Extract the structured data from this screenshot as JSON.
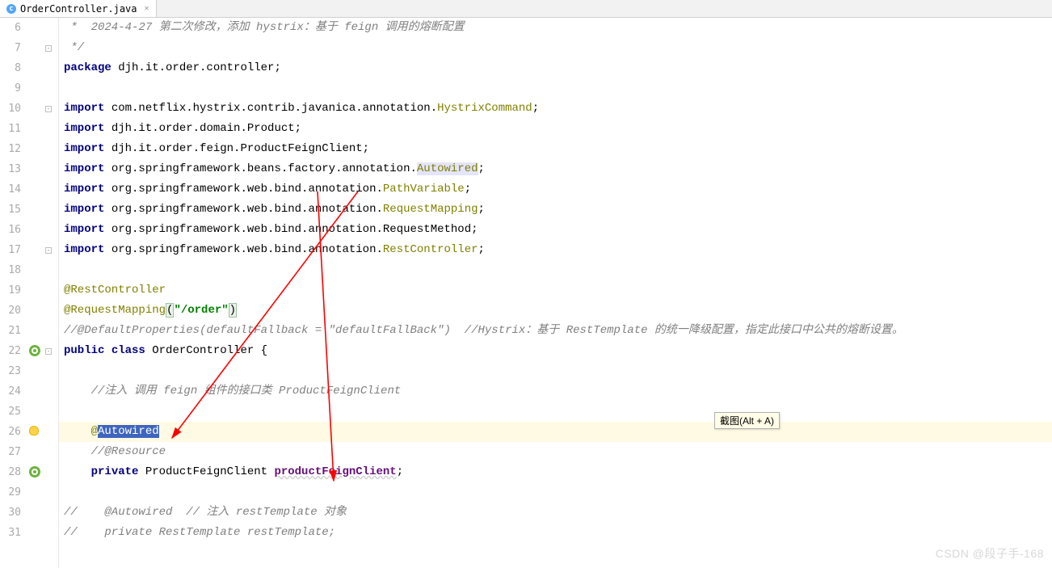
{
  "tabs": {
    "file_name": "OrderController.java",
    "file_icon_letter": "c"
  },
  "line_numbers": [
    "6",
    "7",
    "8",
    "9",
    "10",
    "11",
    "12",
    "13",
    "14",
    "15",
    "16",
    "17",
    "18",
    "19",
    "20",
    "21",
    "22",
    "23",
    "24",
    "25",
    "26",
    "27",
    "28",
    "29",
    "30",
    "31"
  ],
  "tooltip": "截图(Alt + A)",
  "watermark": "CSDN @段子手-168",
  "tokens": {
    "kw_package": "package",
    "kw_import": "import",
    "kw_public": "public",
    "kw_class": "class",
    "kw_private": "private",
    "pkg_name": " djh.it.order.controller;",
    "imp1_pre": " com.netflix.hystrix.contrib.javanica.annotation.",
    "imp1_cls": "HystrixCommand",
    "imp2": " djh.it.order.domain.Product;",
    "imp3": " djh.it.order.feign.ProductFeignClient;",
    "imp4_pre": " org.springframework.beans.factory.annotation.",
    "imp4_cls": "Autowired",
    "imp5_pre": " org.springframework.web.bind.annotation.",
    "imp5_cls": "PathVariable",
    "imp6_cls": "RequestMapping",
    "imp7_cls": "RequestMethod;",
    "imp8_cls": "RestController",
    "ann_rest": "@RestController",
    "ann_reqmap": "@RequestMapping",
    "reqmap_val": "\"/order\"",
    "comment_top": " *  2024-4-27 第二次修改，添加 hystrix：基于 feign 调用的熔断配置",
    "comment_end": " */",
    "comment_defprop": "//@DefaultProperties(defaultFallback = \"defaultFallBack\")  //Hystrix：基于 RestTemplate 的统一降级配置，指定此接口中公共的熔断设置。",
    "comment_inject": "    //注入 调用 feign 组件的接口类 ProductFeignClient",
    "comment_resource": "    //@Resource",
    "comment_autowired_line": "//    @Autowired  // 注入 restTemplate 对象",
    "comment_resttemplate": "//    private RestTemplate restTemplate;",
    "at": "@",
    "autowired_sel": "Autowired",
    "class_decl": " OrderController {",
    "priv_pre": " ProductFeignClient ",
    "field_name": "productFeignClient",
    "semi": ";",
    "open_paren": "(",
    "close_paren": ")",
    "indent4": "    "
  }
}
